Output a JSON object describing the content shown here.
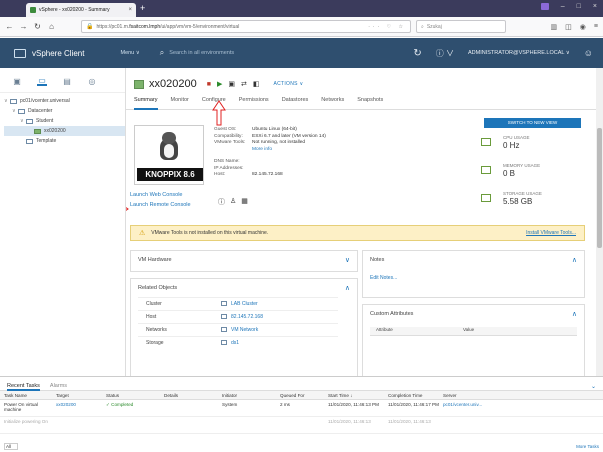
{
  "browser": {
    "tab_title": "vSphere - xx020200 - Summary",
    "url_prefix": "https://pc01.m.",
    "url_host": "fsaitcom.lmph",
    "url_rest": "/ui/app/vm/vm-5/environment/virtual",
    "search_placeholder": "Szukaj"
  },
  "vsphere": {
    "app_title": "vSphere Client",
    "menu_label": "Menu ∨",
    "search_placeholder": "Search in all environments",
    "user_label": "ADMINISTRATOR@VSPHERE.LOCAL ∨"
  },
  "sidebar": {
    "tree": [
      {
        "label": "pc01/vcenter.universal",
        "level": 0
      },
      {
        "label": "Datacenter",
        "level": 1
      },
      {
        "label": "Student",
        "level": 2
      },
      {
        "label": "xx020200",
        "level": 3,
        "selected": true
      },
      {
        "label": "Template",
        "level": 2
      }
    ]
  },
  "object": {
    "name": "xx020200",
    "actions_label": "ACTIONS ∨",
    "tabs": [
      "Summary",
      "Monitor",
      "Configure",
      "Permissions",
      "Datastores",
      "Networks",
      "Snapshots"
    ],
    "active_tab": "Summary"
  },
  "summary": {
    "switch_label": "SWITCH TO NEW VIEW",
    "console_brand": "KNOPPIX 8.6",
    "launch_web": "Launch Web Console",
    "launch_remote": "Launch Remote Console",
    "details": [
      {
        "k": "Guest OS:",
        "v": "Ubuntu Linux (64-bit)"
      },
      {
        "k": "Compatibility:",
        "v": "ESXi 6.7 and later (VM version 14)"
      },
      {
        "k": "VMware Tools:",
        "v": "Not running, not installed"
      },
      {
        "k": "",
        "v": "More info",
        "link": true
      },
      {
        "k": "DNS Name:",
        "v": ""
      },
      {
        "k": "IP Addresses:",
        "v": ""
      },
      {
        "k": "Host:",
        "v": "82.145.72.168"
      }
    ],
    "usage": [
      {
        "label": "CPU USAGE",
        "value": "0 Hz"
      },
      {
        "label": "MEMORY USAGE",
        "value": "0 B"
      },
      {
        "label": "STORAGE USAGE",
        "value": "5.58 GB"
      }
    ],
    "warning": "VMware Tools is not installed on this virtual machine.",
    "install_link": "Install VMware Tools..."
  },
  "panels": {
    "vm_hardware": "VM Hardware",
    "notes": "Notes",
    "edit_notes": "Edit Notes...",
    "related_objects": "Related Objects",
    "related": [
      {
        "k": "Cluster",
        "v": "LAB Cluster"
      },
      {
        "k": "Host",
        "v": "82.145.72.168"
      },
      {
        "k": "Networks",
        "v": "VM Network"
      },
      {
        "k": "Storage",
        "v": "ds1"
      }
    ],
    "custom_attributes": "Custom Attributes",
    "attr_col": "Attribute",
    "value_col": "Value"
  },
  "tasks": {
    "tab_recent": "Recent Tasks",
    "tab_alarms": "Alarms",
    "columns": [
      "Task Name",
      "Target",
      "Status",
      "Details",
      "Initiator",
      "Queued For",
      "Start Time ↓",
      "Completion Time",
      "Server"
    ],
    "rows": [
      {
        "name": "Power On virtual machine",
        "target": "xx020200",
        "status": "✓ Completed",
        "details": "",
        "initiator": "System",
        "queued": "2 ms",
        "start": "11/01/2020, 11:46:13 PM",
        "completion": "11/01/2020, 11:46:17 PM",
        "server": "pc01/vcenter.univ..."
      },
      {
        "name": "Initialize powering On",
        "target": "",
        "status": "",
        "details": "",
        "initiator": "",
        "queued": "",
        "start": "11/01/2020, 11:46:13",
        "completion": "11/01/2020, 11:46:13",
        "server": ""
      }
    ],
    "page_select": "All",
    "more_tasks": "More Tasks"
  }
}
